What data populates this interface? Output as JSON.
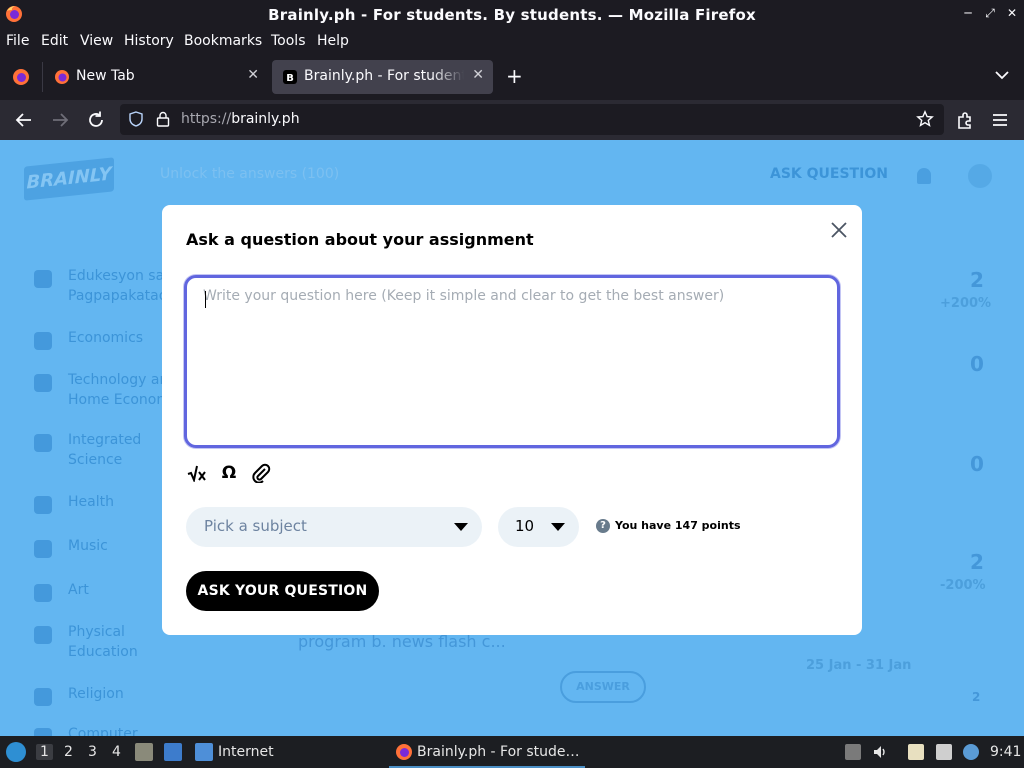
{
  "window": {
    "title": "Brainly.ph - For students. By students. — Mozilla Firefox"
  },
  "menu": {
    "file": "File",
    "edit": "Edit",
    "view": "View",
    "history": "History",
    "bookmarks": "Bookmarks",
    "tools": "Tools",
    "help": "Help"
  },
  "tabs": [
    {
      "label": "New Tab",
      "active": false
    },
    {
      "label": "Brainly.ph - For students. By students.",
      "active": true
    }
  ],
  "urlbar": {
    "scheme": "https://",
    "host": "brainly.ph"
  },
  "background": {
    "logo_text": "BRAINLY",
    "search_text": "Unlock the answers (100)",
    "ask_question": "ASK QUESTION",
    "subjects": [
      {
        "line1": "Edukesyon sa",
        "line2": "Pagpapakatao"
      },
      {
        "line1": "Economics",
        "line2": ""
      },
      {
        "line1": "Technology and",
        "line2": "Home Economics"
      },
      {
        "line1": "Integrated",
        "line2": "Science"
      },
      {
        "line1": "Health",
        "line2": ""
      },
      {
        "line1": "Music",
        "line2": ""
      },
      {
        "line1": "Art",
        "line2": ""
      },
      {
        "line1": "Physical",
        "line2": "Education"
      },
      {
        "line1": "Religion",
        "line2": ""
      },
      {
        "line1": "Computer",
        "line2": ""
      }
    ],
    "stats": [
      "2",
      "0",
      "0",
      "2",
      "2"
    ],
    "stat_percent_1": "+200%",
    "stat_percent_2": "-200%",
    "date_range": "25 Jan - 31 Jan",
    "news_text": "program b. news flash c...",
    "answer_button": "ANSWER"
  },
  "modal": {
    "title": "Ask a question about your assignment",
    "question_placeholder": "Write your question here (Keep it simple and clear to get the best answer)",
    "tools": [
      "sqrt-formula-icon",
      "omega-symbol-icon",
      "attachment-icon"
    ],
    "subject_placeholder": "Pick a subject",
    "points_value": "10",
    "points_info": "You have 147 points",
    "ask_button": "ASK YOUR QUESTION"
  },
  "taskbar": {
    "workspaces": [
      "1",
      "2",
      "3",
      "4"
    ],
    "internet_label": "Internet",
    "task_label": "Brainly.ph - For stude…",
    "clock": "9:41"
  }
}
